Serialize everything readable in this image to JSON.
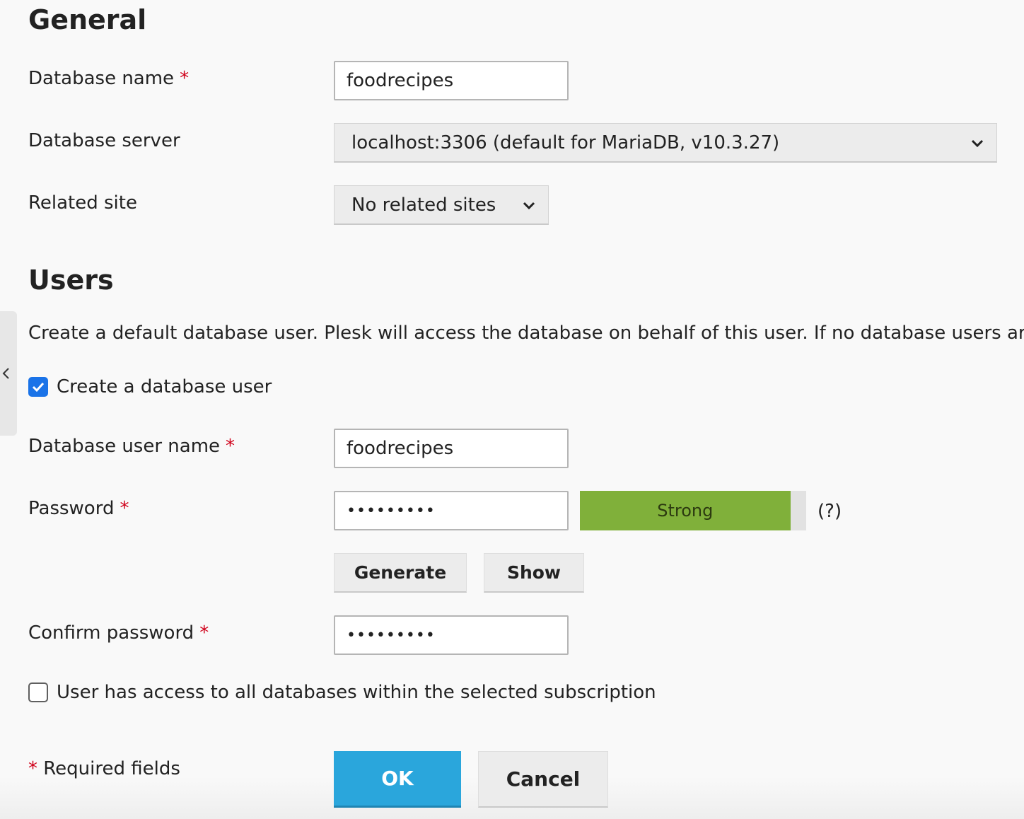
{
  "general": {
    "heading": "General",
    "db_name_label": "Database name",
    "db_name_value": "foodrecipes",
    "db_server_label": "Database server",
    "db_server_value": "localhost:3306 (default for MariaDB, v10.3.27)",
    "related_site_label": "Related site",
    "related_site_value": "No related sites"
  },
  "users": {
    "heading": "Users",
    "description": "Create a default database user. Plesk will access the database on behalf of this user. If no database users are",
    "create_user_label": "Create a database user",
    "create_user_checked": true,
    "user_name_label": "Database user name",
    "user_name_value": "foodrecipes",
    "password_label": "Password",
    "password_value": "•••••••••",
    "strength_text": "Strong",
    "strength_fraction": 0.93,
    "strength_color": "#80b03a",
    "help_text": "(?)",
    "generate_label": "Generate",
    "show_label": "Show",
    "confirm_label": "Confirm password",
    "confirm_value": "•••••••••",
    "all_access_label": "User has access to all databases within the selected subscription",
    "all_access_checked": false
  },
  "footer": {
    "required_star": "*",
    "required_text": "Required fields",
    "ok_label": "OK",
    "cancel_label": "Cancel"
  },
  "required_mark": "*",
  "colors": {
    "accent": "#2aa6dc",
    "required": "#d0021b",
    "checkbox": "#1a73e8"
  }
}
